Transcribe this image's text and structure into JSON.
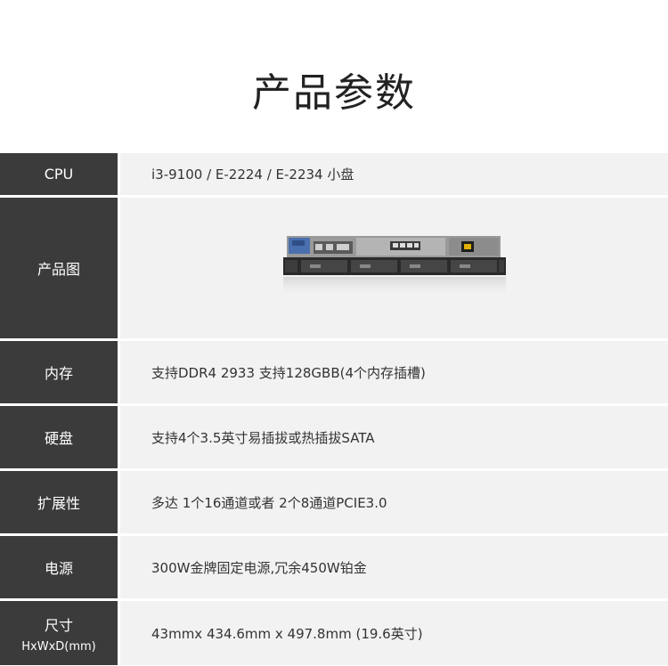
{
  "page_title": "产品参数",
  "rows": [
    {
      "label": "CPU",
      "value": "i3-9100 / E-2224 / E-2234 小盘"
    },
    {
      "label": "产品图"
    },
    {
      "label": "内存",
      "value": "支持DDR4 2933 支持128GBB(4个内存插槽)"
    },
    {
      "label": "硬盘",
      "value": "支持4个3.5英寸易插拔或热插拔SATA"
    },
    {
      "label": "扩展性",
      "value": "多达 1个16通道或者 2个8通道PCIE3.0"
    },
    {
      "label": "电源",
      "value": "300W金牌固定电源,冗余450W铂金"
    },
    {
      "label": "尺寸",
      "label_sub": "HxWxD(mm)",
      "value": "43mmx 434.6mm x 497.8mm (19.6英寸)"
    }
  ]
}
